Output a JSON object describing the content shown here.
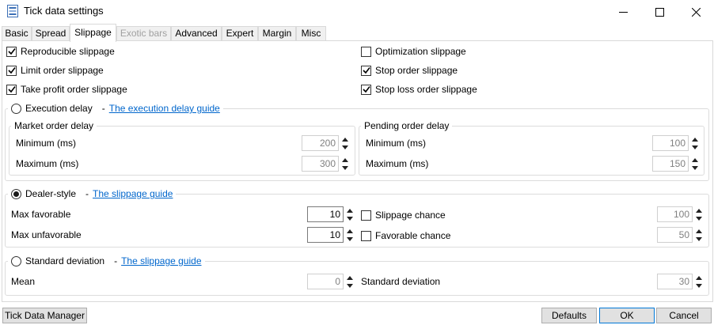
{
  "window": {
    "title": "Tick data settings"
  },
  "tabs": [
    "Basic",
    "Spread",
    "Slippage",
    "Exotic bars",
    "Advanced",
    "Expert",
    "Margin",
    "Misc"
  ],
  "options": {
    "reproducible": {
      "label": "Reproducible slippage",
      "checked": true
    },
    "limit": {
      "label": "Limit order slippage",
      "checked": true
    },
    "take_profit": {
      "label": "Take profit order slippage",
      "checked": true
    },
    "optimization": {
      "label": "Optimization slippage",
      "checked": false
    },
    "stop": {
      "label": "Stop order slippage",
      "checked": true
    },
    "stop_loss": {
      "label": "Stop loss order slippage",
      "checked": true
    }
  },
  "execution_delay": {
    "label": "Execution delay",
    "separator": "-",
    "guide": "The execution delay guide",
    "selected": false,
    "market": {
      "title": "Market order delay",
      "min_label": "Minimum (ms)",
      "min_value": "200",
      "max_label": "Maximum (ms)",
      "max_value": "300"
    },
    "pending": {
      "title": "Pending order delay",
      "min_label": "Minimum (ms)",
      "min_value": "100",
      "max_label": "Maximum (ms)",
      "max_value": "150"
    }
  },
  "dealer": {
    "label": "Dealer-style",
    "separator": "-",
    "guide": "The slippage guide",
    "selected": true,
    "max_favorable_label": "Max favorable",
    "max_favorable_value": "10",
    "max_unfavorable_label": "Max unfavorable",
    "max_unfavorable_value": "10",
    "slippage_chance_label": "Slippage chance",
    "slippage_chance_value": "100",
    "favorable_chance_label": "Favorable chance",
    "favorable_chance_value": "50"
  },
  "stddev": {
    "label": "Standard deviation",
    "separator": "-",
    "guide": "The slippage guide",
    "selected": false,
    "mean_label": "Mean",
    "mean_value": "0",
    "std_label": "Standard deviation",
    "std_value": "30"
  },
  "buttons": {
    "tick_data_manager": "Tick Data Manager",
    "defaults": "Defaults",
    "ok": "OK",
    "cancel": "Cancel"
  },
  "colors": {
    "link": "#0066cc",
    "accent_border": "#0078d7"
  }
}
